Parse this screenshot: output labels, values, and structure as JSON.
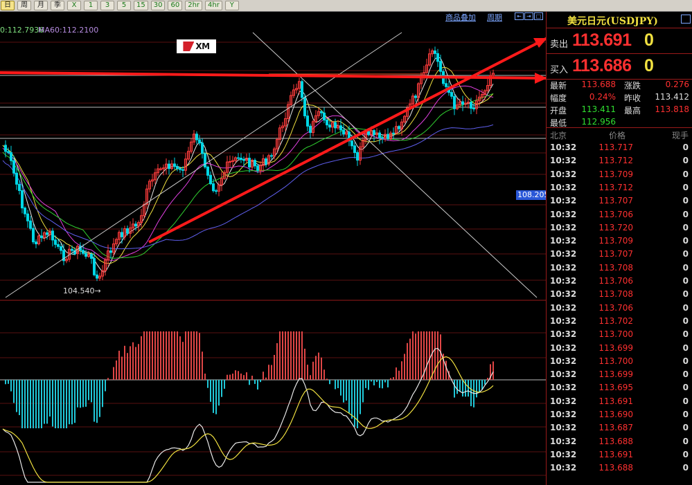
{
  "toolbar": {
    "buttons": [
      {
        "label": "日",
        "active": true
      },
      {
        "label": "周",
        "active": false
      },
      {
        "label": "月",
        "active": false
      },
      {
        "label": "季",
        "active": false
      },
      {
        "label": "X",
        "active": false
      },
      {
        "label": "1",
        "active": false
      },
      {
        "label": "3",
        "active": false
      },
      {
        "label": "5",
        "active": false
      },
      {
        "label": "15",
        "active": false
      },
      {
        "label": "30",
        "active": false
      },
      {
        "label": "60",
        "active": false
      },
      {
        "label": "2hr",
        "active": false
      },
      {
        "label": "4hr",
        "active": false
      },
      {
        "label": "Y",
        "active": false
      }
    ]
  },
  "chart": {
    "ma_a": "0:112.7936",
    "ma_b": "MA60:112.2100",
    "overlay_link": "商品叠加",
    "period_link": "周期",
    "price_tag": "108.205",
    "low_label": "104.540",
    "logo_text": "XM",
    "colors": {
      "up": "#ff3c3c",
      "down": "#00d7e6",
      "macd_pos": "#e04646",
      "macd_neg": "#20c8d8",
      "trend": "#ff1a1a"
    }
  },
  "side": {
    "title": "美元日元(USDJPY)",
    "sell_label": "卖出",
    "sell_price": "113.691",
    "sell_vol": "0",
    "buy_label": "买入",
    "buy_price": "113.686",
    "buy_vol": "0",
    "stats": [
      [
        {
          "label": "最新",
          "value": "113.688",
          "color": "#ff3030"
        },
        {
          "label": "涨跌",
          "value": "0.276",
          "color": "#ff3030"
        }
      ],
      [
        {
          "label": "幅度",
          "value": "0.24%",
          "color": "#ff3030"
        },
        {
          "label": "昨收",
          "value": "113.412",
          "color": "#dddddd"
        }
      ],
      [
        {
          "label": "开盘",
          "value": "113.411",
          "color": "#30e030"
        },
        {
          "label": "最高",
          "value": "113.818",
          "color": "#ff3030"
        }
      ],
      [
        {
          "label": "最低",
          "value": "112.956",
          "color": "#30e030"
        }
      ]
    ],
    "tick_headers": {
      "time": "北京",
      "price": "价格",
      "vol": "现手"
    },
    "ticks": [
      {
        "time": "10:32",
        "price": "113.717",
        "vol": "0"
      },
      {
        "time": "10:32",
        "price": "113.712",
        "vol": "0"
      },
      {
        "time": "10:32",
        "price": "113.709",
        "vol": "0"
      },
      {
        "time": "10:32",
        "price": "113.712",
        "vol": "0"
      },
      {
        "time": "10:32",
        "price": "113.707",
        "vol": "0"
      },
      {
        "time": "10:32",
        "price": "113.706",
        "vol": "0"
      },
      {
        "time": "10:32",
        "price": "113.720",
        "vol": "0"
      },
      {
        "time": "10:32",
        "price": "113.709",
        "vol": "0"
      },
      {
        "time": "10:32",
        "price": "113.707",
        "vol": "0"
      },
      {
        "time": "10:32",
        "price": "113.708",
        "vol": "0"
      },
      {
        "time": "10:32",
        "price": "113.706",
        "vol": "0"
      },
      {
        "time": "10:32",
        "price": "113.708",
        "vol": "0"
      },
      {
        "time": "10:32",
        "price": "113.706",
        "vol": "0"
      },
      {
        "time": "10:32",
        "price": "113.702",
        "vol": "0"
      },
      {
        "time": "10:32",
        "price": "113.700",
        "vol": "0"
      },
      {
        "time": "10:32",
        "price": "113.699",
        "vol": "0"
      },
      {
        "time": "10:32",
        "price": "113.700",
        "vol": "0"
      },
      {
        "time": "10:32",
        "price": "113.699",
        "vol": "0"
      },
      {
        "time": "10:32",
        "price": "113.695",
        "vol": "0"
      },
      {
        "time": "10:32",
        "price": "113.691",
        "vol": "0"
      },
      {
        "time": "10:32",
        "price": "113.690",
        "vol": "0"
      },
      {
        "time": "10:32",
        "price": "113.687",
        "vol": "0"
      },
      {
        "time": "10:32",
        "price": "113.688",
        "vol": "0"
      },
      {
        "time": "10:32",
        "price": "113.691",
        "vol": "0"
      },
      {
        "time": "10:32",
        "price": "113.688",
        "vol": "0"
      }
    ]
  }
}
